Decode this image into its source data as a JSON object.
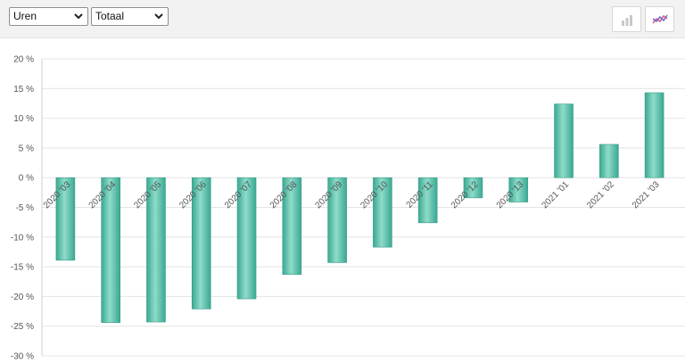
{
  "toolbar": {
    "metric_select": {
      "value": "Uren"
    },
    "mode_select": {
      "value": "Totaal"
    },
    "buttons": [
      {
        "icon": "bar-chart-icon"
      },
      {
        "icon": "line-chart-icon"
      }
    ]
  },
  "chart_data": {
    "type": "bar",
    "title": "",
    "xlabel": "",
    "ylabel": "",
    "ylim": [
      -30,
      20
    ],
    "y_tick_step": 5,
    "y_tick_suffix": " %",
    "grid": true,
    "bar_color": "#54bfa8",
    "categories": [
      "2020 '03",
      "2020 '04",
      "2020 '05",
      "2020 '06",
      "2020 '07",
      "2020 '08",
      "2020 '09",
      "2020 '10",
      "2020 '11",
      "2020 '12",
      "2020 '13",
      "2021 '01",
      "2021 '02",
      "2021 '03"
    ],
    "values": [
      -13.9,
      -24.4,
      -24.3,
      -22.1,
      -20.4,
      -16.3,
      -14.3,
      -11.7,
      -7.6,
      -3.4,
      -4.1,
      12.4,
      5.6,
      14.3
    ]
  }
}
